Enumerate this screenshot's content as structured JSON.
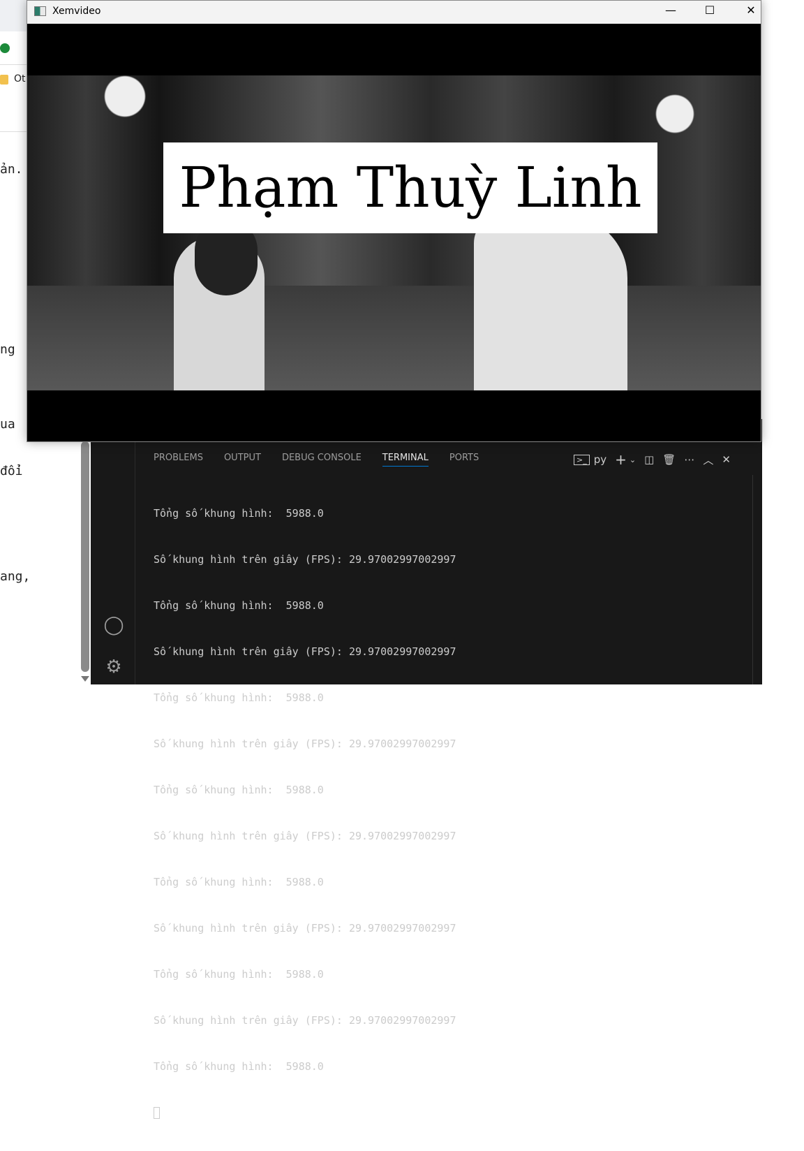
{
  "background_doc": {
    "lines": [
      "ản.",
      "ng",
      "ua",
      "đổi",
      "ang,"
    ],
    "folder_label": "Ot"
  },
  "window": {
    "title": "Xemvideo",
    "minimize": "—",
    "maximize": "☐",
    "close": "✕",
    "overlay_text": "Phạm Thuỳ Linh"
  },
  "panel": {
    "tabs": [
      {
        "label": "PROBLEMS"
      },
      {
        "label": "OUTPUT"
      },
      {
        "label": "DEBUG CONSOLE"
      },
      {
        "label": "TERMINAL",
        "active": true
      },
      {
        "label": "PORTS"
      }
    ],
    "terminal_shell": "py",
    "accent": "#0078d4"
  },
  "terminal": {
    "lines": [
      "Tổng số khung hình:  5988.0",
      "Số khung hình trên giây (FPS): 29.97002997002997",
      "Tổng số khung hình:  5988.0",
      "Số khung hình trên giây (FPS): 29.97002997002997",
      "Tổng số khung hình:  5988.0",
      "Số khung hình trên giây (FPS): 29.97002997002997",
      "Tổng số khung hình:  5988.0",
      "Số khung hình trên giây (FPS): 29.97002997002997",
      "Tổng số khung hình:  5988.0",
      "Số khung hình trên giây (FPS): 29.97002997002997",
      "Tổng số khung hình:  5988.0",
      "Số khung hình trên giây (FPS): 29.97002997002997",
      "Tổng số khung hình:  5988.0"
    ]
  }
}
